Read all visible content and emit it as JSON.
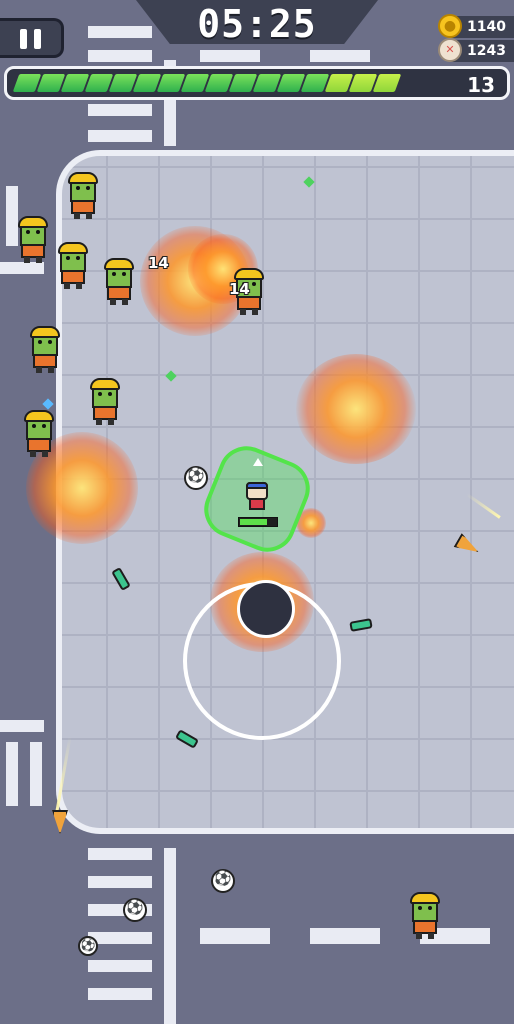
{
  "hud": {
    "timer": "05:25",
    "coins": "1140",
    "kills": "1243",
    "level": "13",
    "xp_progress": 0.8,
    "xp_segments_filled": 16,
    "xp_segments_total": 20
  },
  "icons": {
    "pause": "pause-icon",
    "coin": "coin-icon",
    "kills": "skull-icon"
  },
  "player": {
    "health_fraction": 0.75
  },
  "damage_numbers": [
    "14",
    "14"
  ],
  "colors": {
    "aura": "#53e44a",
    "xp_fill": "#5cd54a",
    "fire": "#ff8a1e",
    "zombie_skin": "#7fbf4d",
    "zombie_vest": "#e9742d",
    "helmet": "#f4c51e"
  }
}
